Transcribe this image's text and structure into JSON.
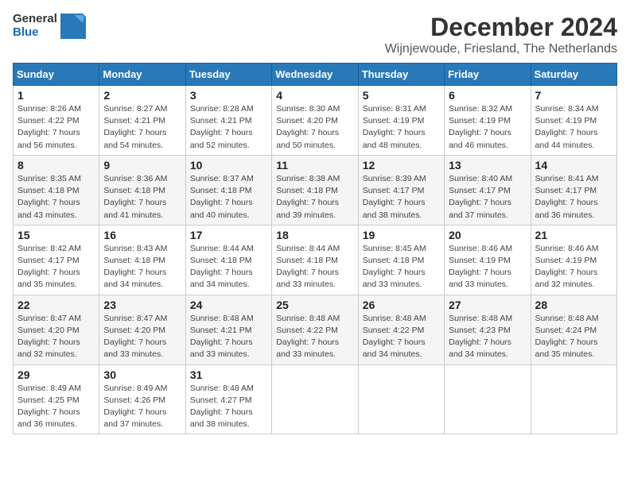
{
  "header": {
    "logo_general": "General",
    "logo_blue": "Blue",
    "title": "December 2024",
    "subtitle": "Wijnjewoude, Friesland, The Netherlands"
  },
  "calendar": {
    "days_of_week": [
      "Sunday",
      "Monday",
      "Tuesday",
      "Wednesday",
      "Thursday",
      "Friday",
      "Saturday"
    ],
    "weeks": [
      [
        null,
        {
          "day": 2,
          "sunrise": "8:27 AM",
          "sunset": "4:21 PM",
          "daylight": "7 hours and 54 minutes."
        },
        {
          "day": 3,
          "sunrise": "8:28 AM",
          "sunset": "4:21 PM",
          "daylight": "7 hours and 52 minutes."
        },
        {
          "day": 4,
          "sunrise": "8:30 AM",
          "sunset": "4:20 PM",
          "daylight": "7 hours and 50 minutes."
        },
        {
          "day": 5,
          "sunrise": "8:31 AM",
          "sunset": "4:19 PM",
          "daylight": "7 hours and 48 minutes."
        },
        {
          "day": 6,
          "sunrise": "8:32 AM",
          "sunset": "4:19 PM",
          "daylight": "7 hours and 46 minutes."
        },
        {
          "day": 7,
          "sunrise": "8:34 AM",
          "sunset": "4:19 PM",
          "daylight": "7 hours and 44 minutes."
        }
      ],
      [
        {
          "day": 8,
          "sunrise": "8:35 AM",
          "sunset": "4:18 PM",
          "daylight": "7 hours and 43 minutes."
        },
        {
          "day": 9,
          "sunrise": "8:36 AM",
          "sunset": "4:18 PM",
          "daylight": "7 hours and 41 minutes."
        },
        {
          "day": 10,
          "sunrise": "8:37 AM",
          "sunset": "4:18 PM",
          "daylight": "7 hours and 40 minutes."
        },
        {
          "day": 11,
          "sunrise": "8:38 AM",
          "sunset": "4:18 PM",
          "daylight": "7 hours and 39 minutes."
        },
        {
          "day": 12,
          "sunrise": "8:39 AM",
          "sunset": "4:17 PM",
          "daylight": "7 hours and 38 minutes."
        },
        {
          "day": 13,
          "sunrise": "8:40 AM",
          "sunset": "4:17 PM",
          "daylight": "7 hours and 37 minutes."
        },
        {
          "day": 14,
          "sunrise": "8:41 AM",
          "sunset": "4:17 PM",
          "daylight": "7 hours and 36 minutes."
        }
      ],
      [
        {
          "day": 15,
          "sunrise": "8:42 AM",
          "sunset": "4:17 PM",
          "daylight": "7 hours and 35 minutes."
        },
        {
          "day": 16,
          "sunrise": "8:43 AM",
          "sunset": "4:18 PM",
          "daylight": "7 hours and 34 minutes."
        },
        {
          "day": 17,
          "sunrise": "8:44 AM",
          "sunset": "4:18 PM",
          "daylight": "7 hours and 34 minutes."
        },
        {
          "day": 18,
          "sunrise": "8:44 AM",
          "sunset": "4:18 PM",
          "daylight": "7 hours and 33 minutes."
        },
        {
          "day": 19,
          "sunrise": "8:45 AM",
          "sunset": "4:18 PM",
          "daylight": "7 hours and 33 minutes."
        },
        {
          "day": 20,
          "sunrise": "8:46 AM",
          "sunset": "4:19 PM",
          "daylight": "7 hours and 33 minutes."
        },
        {
          "day": 21,
          "sunrise": "8:46 AM",
          "sunset": "4:19 PM",
          "daylight": "7 hours and 32 minutes."
        }
      ],
      [
        {
          "day": 22,
          "sunrise": "8:47 AM",
          "sunset": "4:20 PM",
          "daylight": "7 hours and 32 minutes."
        },
        {
          "day": 23,
          "sunrise": "8:47 AM",
          "sunset": "4:20 PM",
          "daylight": "7 hours and 33 minutes."
        },
        {
          "day": 24,
          "sunrise": "8:48 AM",
          "sunset": "4:21 PM",
          "daylight": "7 hours and 33 minutes."
        },
        {
          "day": 25,
          "sunrise": "8:48 AM",
          "sunset": "4:22 PM",
          "daylight": "7 hours and 33 minutes."
        },
        {
          "day": 26,
          "sunrise": "8:48 AM",
          "sunset": "4:22 PM",
          "daylight": "7 hours and 34 minutes."
        },
        {
          "day": 27,
          "sunrise": "8:48 AM",
          "sunset": "4:23 PM",
          "daylight": "7 hours and 34 minutes."
        },
        {
          "day": 28,
          "sunrise": "8:48 AM",
          "sunset": "4:24 PM",
          "daylight": "7 hours and 35 minutes."
        }
      ],
      [
        {
          "day": 29,
          "sunrise": "8:49 AM",
          "sunset": "4:25 PM",
          "daylight": "7 hours and 36 minutes."
        },
        {
          "day": 30,
          "sunrise": "8:49 AM",
          "sunset": "4:26 PM",
          "daylight": "7 hours and 37 minutes."
        },
        {
          "day": 31,
          "sunrise": "8:48 AM",
          "sunset": "4:27 PM",
          "daylight": "7 hours and 38 minutes."
        },
        null,
        null,
        null,
        null
      ]
    ],
    "week1_day1": {
      "day": 1,
      "sunrise": "8:26 AM",
      "sunset": "4:22 PM",
      "daylight": "7 hours and 56 minutes."
    }
  }
}
